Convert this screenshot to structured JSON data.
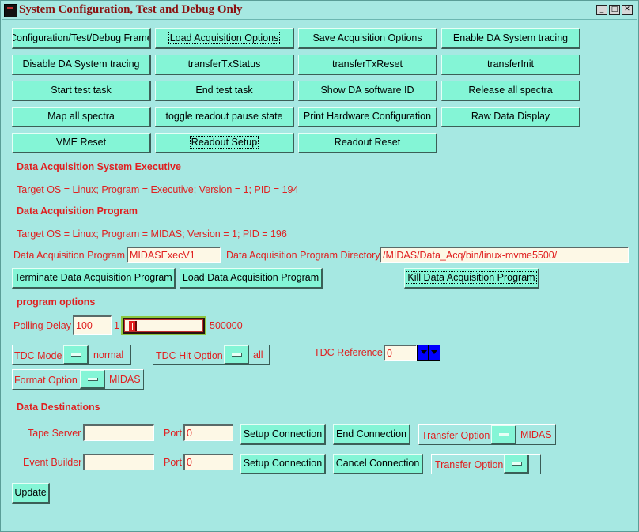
{
  "window": {
    "title": "System Configuration, Test and Debug Only"
  },
  "buttons": {
    "row1": [
      "Configuration/Test/Debug Frame",
      "Load Acquisition Options",
      "Save Acquisition Options",
      "Enable DA System tracing"
    ],
    "row2": [
      "Disable DA System tracing",
      "transferTxStatus",
      "transferTxReset",
      "transferInit"
    ],
    "row3": [
      "Start test task",
      "End test task",
      "Show DA software ID",
      "Release all spectra"
    ],
    "row4": [
      "Map all spectra",
      "toggle readout pause state",
      "Print Hardware Configuration",
      "Raw Data Display"
    ],
    "row5": [
      "VME Reset",
      "Readout Setup",
      "Readout Reset"
    ]
  },
  "executive": {
    "header": "Data Acquisition System Executive",
    "info": "Target OS = Linux;  Program = Executive;  Version = 1; PID = 194"
  },
  "program": {
    "header": "Data Acquisition Program",
    "info": "Target OS = Linux;  Program = MIDAS;  Version = 1; PID = 196",
    "program_label": "Data Acquisition Program",
    "program_value": "MIDASExecV1",
    "directory_label": "Data Acquisition Program Directory",
    "directory_value": "/MIDAS/Data_Acq/bin/linux-mvme5500/",
    "terminate_label": "Terminate Data Acquisition Program",
    "load_label": "Load Data Acquisition Program",
    "kill_label": "Kill Data Acquisition Program"
  },
  "options": {
    "header": "program options",
    "polling_label": "Polling Delay",
    "polling_value": "100",
    "slider_min": "1",
    "slider_max": "500000",
    "slider_level": 0.05,
    "tdc_mode_label": "TDC Mode",
    "tdc_mode_value": "normal",
    "tdc_hit_label": "TDC Hit Option",
    "tdc_hit_value": "all",
    "tdc_ref_label": "TDC Reference",
    "tdc_ref_value": "0",
    "format_label": "Format Option",
    "format_value": "MIDAS"
  },
  "destinations": {
    "header": "Data Destinations",
    "tape_label": "Tape Server",
    "tape_value": "",
    "tape_port_label": "Port",
    "tape_port_value": "0",
    "tape_setup": "Setup Connection",
    "tape_end": "End Connection",
    "tape_transfer_label": "Transfer Option",
    "tape_transfer_value": "MIDAS",
    "eb_label": "Event Builder",
    "eb_value": "",
    "eb_port_label": "Port",
    "eb_port_value": "0",
    "eb_setup": "Setup Connection",
    "eb_cancel": "Cancel Connection",
    "eb_transfer_label": "Transfer Option",
    "eb_transfer_value": ""
  },
  "update_label": "Update",
  "colors": {
    "background": "#a6e8e2",
    "button": "#84f5d6",
    "label": "#e02020",
    "title": "#8b1010",
    "field": "#fdf8e6"
  }
}
